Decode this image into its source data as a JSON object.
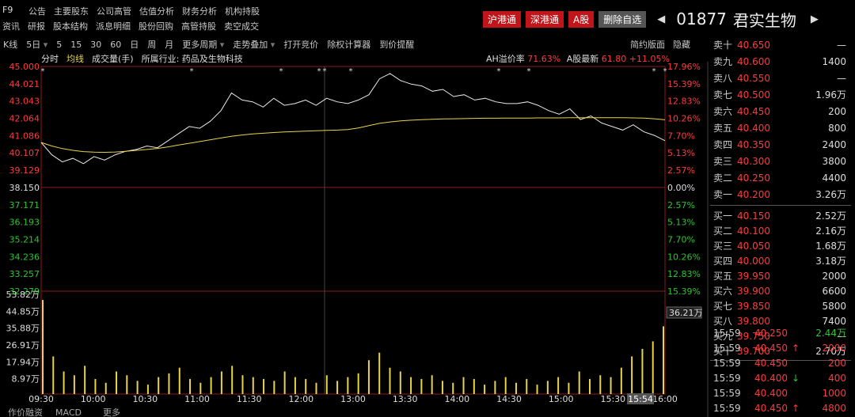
{
  "menu": {
    "f9": "F9",
    "row1": [
      "公告",
      "主要股东",
      "公司高管",
      "估值分析",
      "财务分析",
      "机构持股"
    ],
    "row2": [
      "资讯",
      "研报",
      "股本结构",
      "派息明细",
      "股份回购",
      "高管持股",
      "卖空成交"
    ]
  },
  "header": {
    "buttons": [
      {
        "label": "沪港通",
        "color": "#c0161b"
      },
      {
        "label": "深港通",
        "color": "#c0161b"
      },
      {
        "label": "A股",
        "color": "#c0161b"
      },
      {
        "label": "删除自选",
        "color": "#555555"
      }
    ],
    "prev_arrow": "◀",
    "code": "01877",
    "name": "君实生物",
    "next_arrow": "▶"
  },
  "toolbar": {
    "items": [
      "K线",
      "5日",
      "5",
      "15",
      "30",
      "60",
      "日",
      "周",
      "月",
      "更多周期",
      "走势叠加",
      "打开竞价",
      "除权计算器",
      "到价提醒"
    ],
    "right_buttons": [
      "简约版面",
      "隐藏"
    ]
  },
  "legend": {
    "items": [
      {
        "label": "分时",
        "color": "#dddddd"
      },
      {
        "label": "均线",
        "color": "#e8d44a"
      },
      {
        "label": "成交量(手)",
        "color": "#dddddd"
      },
      {
        "label": "所属行业: 药品及生物科技",
        "color": "#dddddd"
      }
    ],
    "ah_label": "AH溢价率",
    "ah_value": "71.63%",
    "a_label": "A股最新",
    "a_price": "61.80",
    "a_change": "+11.05%"
  },
  "price_axis": {
    "left": [
      "45.000",
      "44.021",
      "43.043",
      "42.064",
      "41.086",
      "40.107",
      "39.129",
      "38.150",
      "37.171",
      "36.193",
      "35.214",
      "34.236",
      "33.257",
      "32.279"
    ],
    "right": [
      "17.96%",
      "15.39%",
      "12.83%",
      "10.26%",
      "7.70%",
      "5.13%",
      "2.57%",
      "0.00%",
      "2.57%",
      "5.13%",
      "7.70%",
      "10.26%",
      "12.83%",
      "15.39%"
    ]
  },
  "volume_axis": {
    "left": [
      "53.82万",
      "44.85万",
      "35.88万",
      "26.91万",
      "17.94万",
      "8.97万"
    ],
    "current_volume": "36.21万"
  },
  "time_axis": [
    "09:30",
    "10:00",
    "10:30",
    "11:00",
    "11:30",
    "12:00",
    "13:00",
    "13:30",
    "14:00",
    "14:30",
    "15:00",
    "15:30",
    "16:00"
  ],
  "cursor_time": "15:54",
  "bottom_tabs": [
    "作价融资",
    "MACD",
    "更多"
  ],
  "chart_data": {
    "type": "line",
    "title": "",
    "xlabel": "",
    "ylabel": "",
    "ylim": [
      32.279,
      45.0
    ],
    "prev_close": 38.15,
    "series": [
      {
        "name": "分时",
        "values": [
          40.7,
          40.0,
          39.6,
          39.8,
          39.5,
          39.9,
          39.7,
          40.0,
          40.2,
          40.3,
          40.5,
          40.4,
          40.8,
          41.2,
          41.6,
          41.5,
          41.9,
          42.5,
          43.5,
          43.1,
          43.0,
          42.7,
          43.2,
          42.8,
          42.9,
          43.1,
          42.8,
          43.2,
          43.0,
          42.9,
          43.1,
          43.4,
          44.3,
          44.6,
          44.2,
          44.0,
          43.9,
          43.6,
          43.7,
          43.3,
          43.4,
          43.1,
          43.2,
          43.0,
          42.9,
          42.9,
          43.0,
          42.8,
          42.5,
          42.3,
          42.6,
          42.0,
          42.2,
          41.8,
          41.6,
          41.4,
          41.7,
          41.3,
          41.1,
          40.8
        ]
      },
      {
        "name": "均线",
        "values": [
          40.7,
          40.5,
          40.35,
          40.25,
          40.18,
          40.15,
          40.14,
          40.16,
          40.2,
          40.25,
          40.3,
          40.36,
          40.45,
          40.55,
          40.65,
          40.75,
          40.85,
          40.95,
          41.05,
          41.12,
          41.18,
          41.22,
          41.26,
          41.29,
          41.32,
          41.34,
          41.36,
          41.38,
          41.4,
          41.43,
          41.52,
          41.65,
          41.78,
          41.86,
          41.92,
          41.96,
          41.99,
          42.01,
          42.03,
          42.04,
          42.05,
          42.06,
          42.07,
          42.07,
          42.08,
          42.08,
          42.08,
          42.09,
          42.09,
          42.09,
          42.1,
          42.1,
          42.1,
          42.1,
          42.1,
          42.1,
          42.09,
          42.08,
          42.04,
          41.98
        ]
      }
    ],
    "volume": [
      50,
      20,
      12,
      10,
      15,
      8,
      6,
      12,
      10,
      7,
      5,
      9,
      11,
      14,
      8,
      6,
      9,
      12,
      15,
      10,
      9,
      8,
      7,
      12,
      9,
      8,
      6,
      10,
      7,
      9,
      11,
      18,
      22,
      14,
      12,
      9,
      8,
      10,
      7,
      6,
      9,
      8,
      5,
      7,
      9,
      6,
      8,
      5,
      7,
      9,
      6,
      12,
      8,
      10,
      9,
      14,
      20,
      24,
      28,
      36
    ],
    "volume_ylim": [
      0,
      53.82
    ]
  },
  "orderbook": {
    "sells": [
      {
        "label": "卖十",
        "price": "40.650",
        "vol": "—"
      },
      {
        "label": "卖九",
        "price": "40.600",
        "vol": "1400"
      },
      {
        "label": "卖八",
        "price": "40.550",
        "vol": "—"
      },
      {
        "label": "卖七",
        "price": "40.500",
        "vol": "1.96万"
      },
      {
        "label": "卖六",
        "price": "40.450",
        "vol": "200"
      },
      {
        "label": "卖五",
        "price": "40.400",
        "vol": "800"
      },
      {
        "label": "卖四",
        "price": "40.350",
        "vol": "2400"
      },
      {
        "label": "卖三",
        "price": "40.300",
        "vol": "3800"
      },
      {
        "label": "卖二",
        "price": "40.250",
        "vol": "4400"
      },
      {
        "label": "卖一",
        "price": "40.200",
        "vol": "3.26万"
      }
    ],
    "buys": [
      {
        "label": "买一",
        "price": "40.150",
        "vol": "2.52万"
      },
      {
        "label": "买二",
        "price": "40.100",
        "vol": "2.16万"
      },
      {
        "label": "买三",
        "price": "40.050",
        "vol": "1.68万"
      },
      {
        "label": "买四",
        "price": "40.000",
        "vol": "3.18万"
      },
      {
        "label": "买五",
        "price": "39.950",
        "vol": "2000"
      },
      {
        "label": "买六",
        "price": "39.900",
        "vol": "6600"
      },
      {
        "label": "买七",
        "price": "39.850",
        "vol": "5800"
      },
      {
        "label": "买八",
        "price": "39.800",
        "vol": "7400"
      },
      {
        "label": "买九",
        "price": "39.750",
        "vol": "—"
      },
      {
        "label": "买十",
        "price": "39.700",
        "vol": "2.70万"
      }
    ]
  },
  "ticks": [
    {
      "time": "15:59",
      "price": "40.250",
      "arrow": "",
      "vol": "2.44万",
      "vol_color": "#2fc42f"
    },
    {
      "time": "15:59",
      "price": "40.450",
      "arrow": "↑",
      "vol": "2000",
      "vol_color": "#ff3b3b"
    },
    {
      "time": "15:59",
      "price": "40.450",
      "arrow": "",
      "vol": "200",
      "vol_color": "#ff3b3b"
    },
    {
      "time": "15:59",
      "price": "40.400",
      "arrow": "↓",
      "vol": "400",
      "vol_color": "#ff3b3b"
    },
    {
      "time": "15:59",
      "price": "40.400",
      "arrow": "",
      "vol": "1000",
      "vol_color": "#ff3b3b"
    },
    {
      "time": "15:59",
      "price": "40.450",
      "arrow": "↑",
      "vol": "4800",
      "vol_color": "#ff3b3b"
    }
  ]
}
